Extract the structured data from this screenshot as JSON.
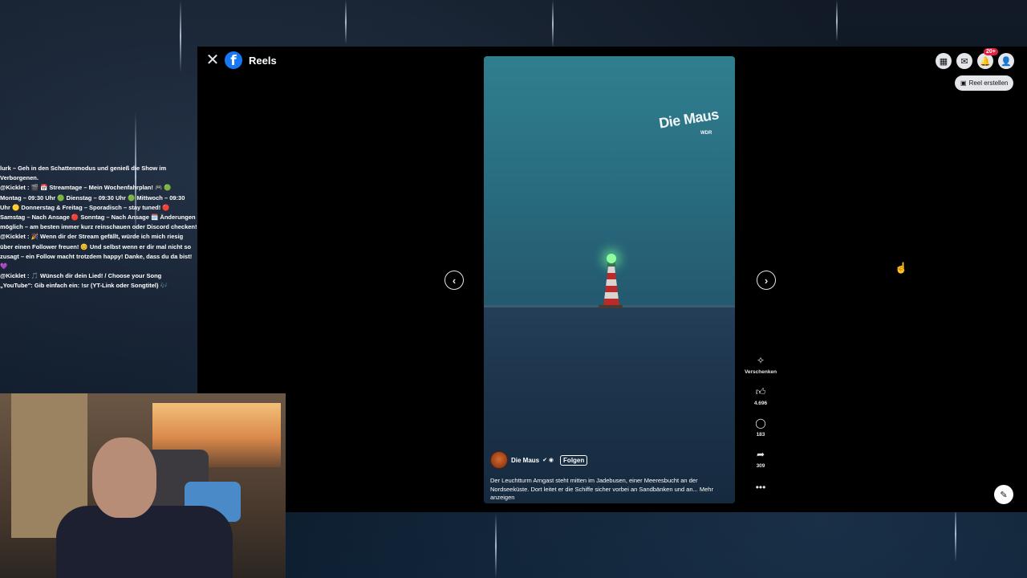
{
  "header": {
    "close_icon": "close-icon",
    "logo_letter": "f",
    "title": "Reels"
  },
  "topbar": {
    "notification_badge": "20+",
    "create_reel_label": "Reel erstellen"
  },
  "video": {
    "watermark": "Die Maus",
    "watermark_sub": "WDR",
    "author": "Die Maus",
    "follow_label": "Folgen",
    "caption": "Der Leuchtturm Arngast steht mitten im Jadebusen, einer Meeresbucht an der Nordseeküste. Dort leitet er die Schiffe sicher vorbei an Sandbänken und an... Mehr anzeigen"
  },
  "actions": {
    "gift_label": "Verschenken",
    "likes": "4.696",
    "comments": "183",
    "shares": "309"
  },
  "chat": {
    "lines": [
      "lurk – Geh in den Schattenmodus und genieß die Show im",
      "Verborgenen.",
      "@Kicklet : 🎬 📅 Streamtage – Mein Wochenfahrplan! 🎮 🟢",
      "Montag – 09:30 Uhr 🟢 Dienstag – 09:30 Uhr 🟢 Mittwoch – 09:30",
      "Uhr 🟡 Donnerstag & Freitag – Sporadisch – stay tuned! 🔴",
      "Samstag – Nach Ansage 🔴 Sonntag – Nach Ansage 🗓️ Änderungen",
      "möglich – am besten immer kurz reinschauen oder Discord checken!",
      "@Kicklet : 🎉 Wenn dir der Stream gefällt, würde ich mich riesig",
      "über einen Follower freuen! 😊 Und selbst wenn er dir mal nicht so",
      "zusagt – ein Follow macht trotzdem happy! Danke, dass du da bist!",
      "💜",
      "@Kicklet : 🎵 Wünsch dir dein Lied! / Choose your Song",
      "„YouTube\": Gib einfach ein: !sr (YT-Link oder Songtitel) 🎶"
    ]
  }
}
